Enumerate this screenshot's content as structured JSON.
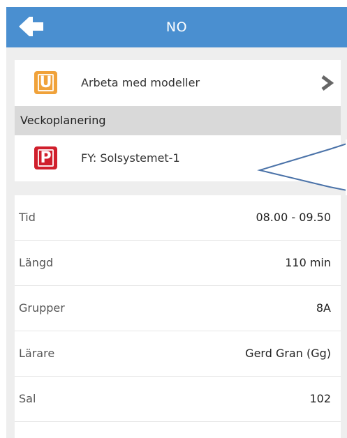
{
  "header": {
    "title": "NO",
    "back_icon": "arrow-left-icon",
    "background": "#4a8fd0"
  },
  "links": [
    {
      "label": "Arbeta med modeller",
      "icon_letter": "U",
      "icon_color": "#f0a23a",
      "icon": "orange-document-icon"
    },
    {
      "label": "FY: Solsystemet-1",
      "icon_letter": "P",
      "icon_color": "#d01f2c",
      "icon": "red-document-icon"
    }
  ],
  "section": {
    "title": "Veckoplanering"
  },
  "details": [
    {
      "label": "Tid",
      "value": "08.00 - 09.50"
    },
    {
      "label": "Längd",
      "value": "110 min"
    },
    {
      "label": "Grupper",
      "value": "8A"
    },
    {
      "label": "Lärare",
      "value": "Gerd Gran (Gg)"
    },
    {
      "label": "Sal",
      "value": "102"
    }
  ]
}
